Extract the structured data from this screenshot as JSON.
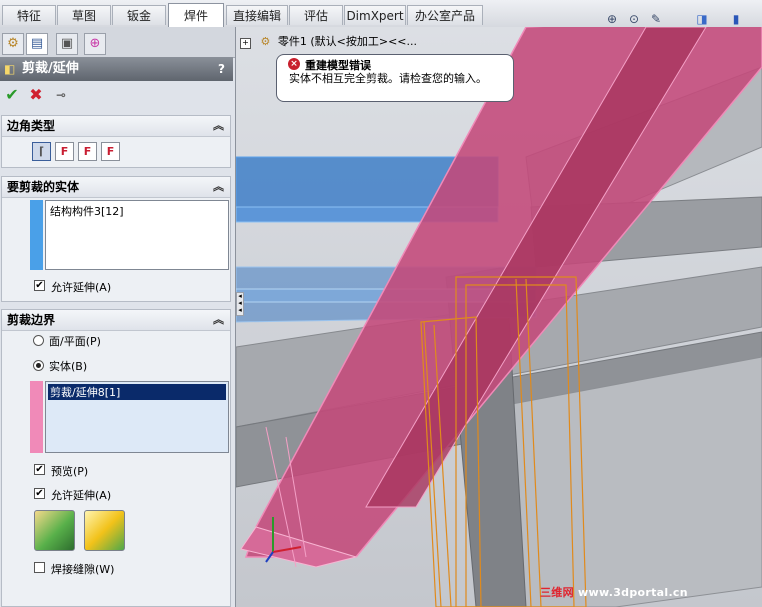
{
  "tabs": [
    "特征",
    "草图",
    "钣金",
    "焊件",
    "直接编辑",
    "评估",
    "DimXpert",
    "办公室产品"
  ],
  "active_tab": "焊件",
  "feature_tree": {
    "root": "零件1 (默认<按加工><<..."
  },
  "panel": {
    "title": "剪裁/延伸",
    "help": "?",
    "corner_group": {
      "title": "边角类型"
    },
    "bodies_group": {
      "title": "要剪裁的实体",
      "items": [
        "结构构件3[12]"
      ],
      "allow_extend": "允许延伸(A)",
      "allow_extend_checked": true
    },
    "boundary_group": {
      "title": "剪裁边界",
      "option_face": "面/平面(P)",
      "option_body": "实体(B)",
      "selected_option": "实体(B)",
      "items": [
        "剪裁/延伸8[1]"
      ],
      "preview": "预览(P)",
      "preview_checked": true,
      "allow_extend": "允许延伸(A)",
      "allow_extend_checked": true,
      "weld_gap": "焊接缝隙(W)",
      "weld_gap_checked": false
    }
  },
  "error": {
    "title": "重建模型错误",
    "message": "实体不相互完全剪裁。请检查您的输入。"
  },
  "watermark": {
    "prefix": "三维网",
    "url": "www.3dportal.cn"
  },
  "colors": {
    "pink_beam": "#c4497a",
    "blue_beam": "#3f7fc8",
    "orange_beam": "#e08a1c",
    "error_red": "#c8202e"
  }
}
